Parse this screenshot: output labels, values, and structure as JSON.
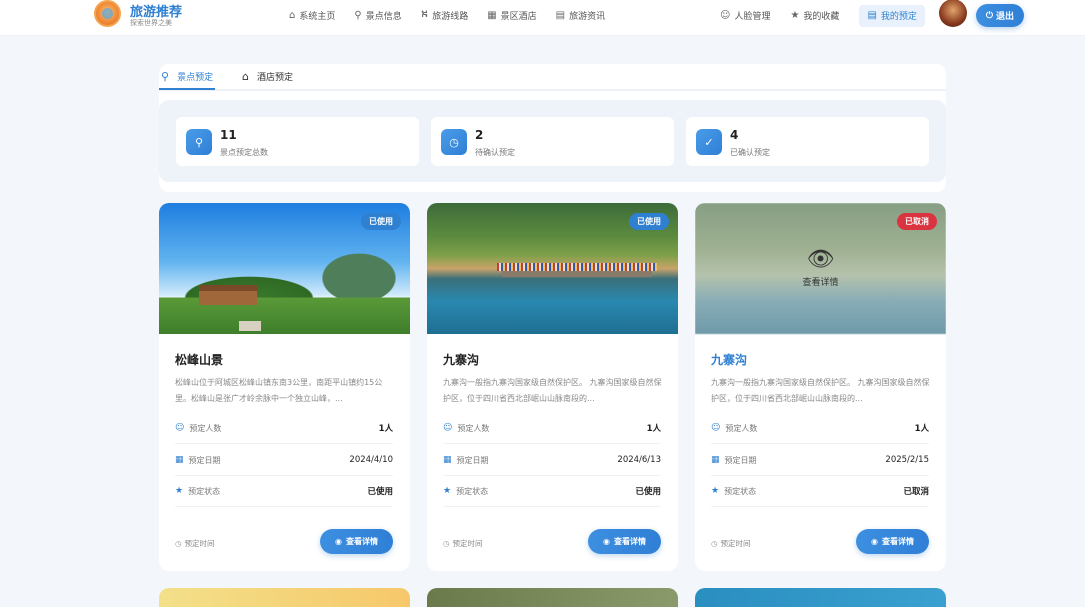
{
  "header": {
    "brand_title": "旅游推荐",
    "brand_sub": "探索世界之美",
    "nav": [
      {
        "label": "系统主页",
        "icon": "home-icon"
      },
      {
        "label": "景点信息",
        "icon": "location-pin-icon"
      },
      {
        "label": "旅游线路",
        "icon": "route-icon"
      },
      {
        "label": "景区酒店",
        "icon": "building-icon"
      },
      {
        "label": "旅游资讯",
        "icon": "document-icon"
      }
    ],
    "right_nav": [
      {
        "label": "人脸管理",
        "icon": "user-icon"
      },
      {
        "label": "我的收藏",
        "icon": "star-icon"
      },
      {
        "label": "我的预定",
        "icon": "list-icon"
      }
    ],
    "logout_label": "退出"
  },
  "tabs": [
    {
      "label": "景点预定",
      "icon": "location-pin-icon"
    },
    {
      "label": "酒店预定",
      "icon": "home-icon"
    }
  ],
  "stats": [
    {
      "number": "11",
      "label": "景点预定总数",
      "icon": "location-pin-icon"
    },
    {
      "number": "2",
      "label": "待确认预定",
      "icon": "clock-icon"
    },
    {
      "number": "4",
      "label": "已确认预定",
      "icon": "check-icon"
    }
  ],
  "field_labels": {
    "people": "预定人数",
    "date": "预定日期",
    "status": "预定状态",
    "time": "预定时间",
    "detail": "查看详情",
    "view_detail_overlay": "查看详情"
  },
  "cards": [
    {
      "badge": "已使用",
      "title": "松峰山景",
      "desc": "松峰山位于阿城区松峰山镇东南3公里，南距平山镇约15公里。松峰山是张广才岭余脉中一个独立山峰，...",
      "people": "1人",
      "date": "2024/4/10",
      "status": "已使用"
    },
    {
      "badge": "已使用",
      "title": "九寨沟",
      "desc": "九寨沟一般指九寨沟国家级自然保护区。 九寨沟国家级自然保护区，位于四川省西北部岷山山脉南段的...",
      "people": "1人",
      "date": "2024/6/13",
      "status": "已使用"
    },
    {
      "badge": "已取消",
      "title": "九寨沟",
      "desc": "九寨沟一般指九寨沟国家级自然保护区。 九寨沟国家级自然保护区，位于四川省西北部岷山山脉南段的...",
      "people": "1人",
      "date": "2025/2/15",
      "status": "已取消"
    }
  ],
  "colors": {
    "primary": "#2f80d1",
    "cancel": "#d9343f"
  }
}
